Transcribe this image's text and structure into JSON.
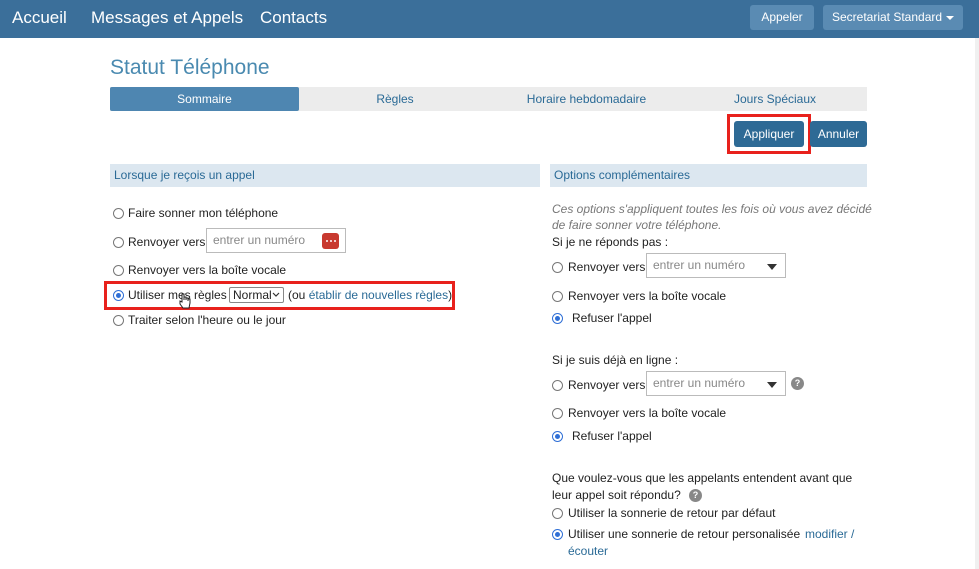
{
  "nav": {
    "home": "Accueil",
    "messages": "Messages et Appels",
    "contacts": "Contacts",
    "call_button": "Appeler",
    "account_button": "Secretariat Standard"
  },
  "page": {
    "title": "Statut Téléphone"
  },
  "tabs": [
    {
      "label": "Sommaire"
    },
    {
      "label": "Règles"
    },
    {
      "label": "Horaire hebdomadaire"
    },
    {
      "label": "Jours Spéciaux"
    }
  ],
  "actions": {
    "apply": "Appliquer",
    "cancel": "Annuler"
  },
  "left": {
    "heading": "Lorsque je reçois un appel",
    "opt_ring": "Faire sonner mon téléphone",
    "opt_forward": "Renvoyer vers",
    "forward_placeholder": "entrer un numéro",
    "opt_voicemail": "Renvoyer vers la boîte vocale",
    "opt_rules": "Utiliser mes règles",
    "rules_select": "Normal",
    "rules_paren_open": "(ou",
    "rules_link": "établir de nouvelles règles",
    "rules_paren_close": ")",
    "opt_schedule": "Traiter selon l'heure ou le jour"
  },
  "right": {
    "heading": "Options complémentaires",
    "note_line1": "Ces options s'appliquent toutes les fois où vous avez décidé",
    "note_line2": "de faire sonner votre téléphone.",
    "no_answer_label": "Si je ne réponds pas :",
    "na_forward": "Renvoyer vers",
    "na_placeholder": "entrer un numéro",
    "na_voicemail": "Renvoyer vers la boîte vocale",
    "na_refuse": "Refuser l'appel",
    "busy_label": "Si je suis déjà en ligne :",
    "busy_forward": "Renvoyer vers",
    "busy_placeholder": "entrer un numéro",
    "busy_voicemail": "Renvoyer vers la boîte vocale",
    "busy_refuse": "Refuser l'appel",
    "ringback_q1": "Que voulez-vous que les appelants entendent avant que",
    "ringback_q2": "leur appel soit répondu?",
    "rb_default": "Utiliser la sonnerie de retour par défaut",
    "rb_custom": "Utiliser une sonnerie de retour personalisée",
    "rb_link1": "modifier /",
    "rb_link2": "écouter"
  },
  "colors": {
    "nav_bg": "#3b6f9a",
    "accent": "#2e6a95",
    "highlight": "#e8211c",
    "radio": "#2f6fd6"
  }
}
